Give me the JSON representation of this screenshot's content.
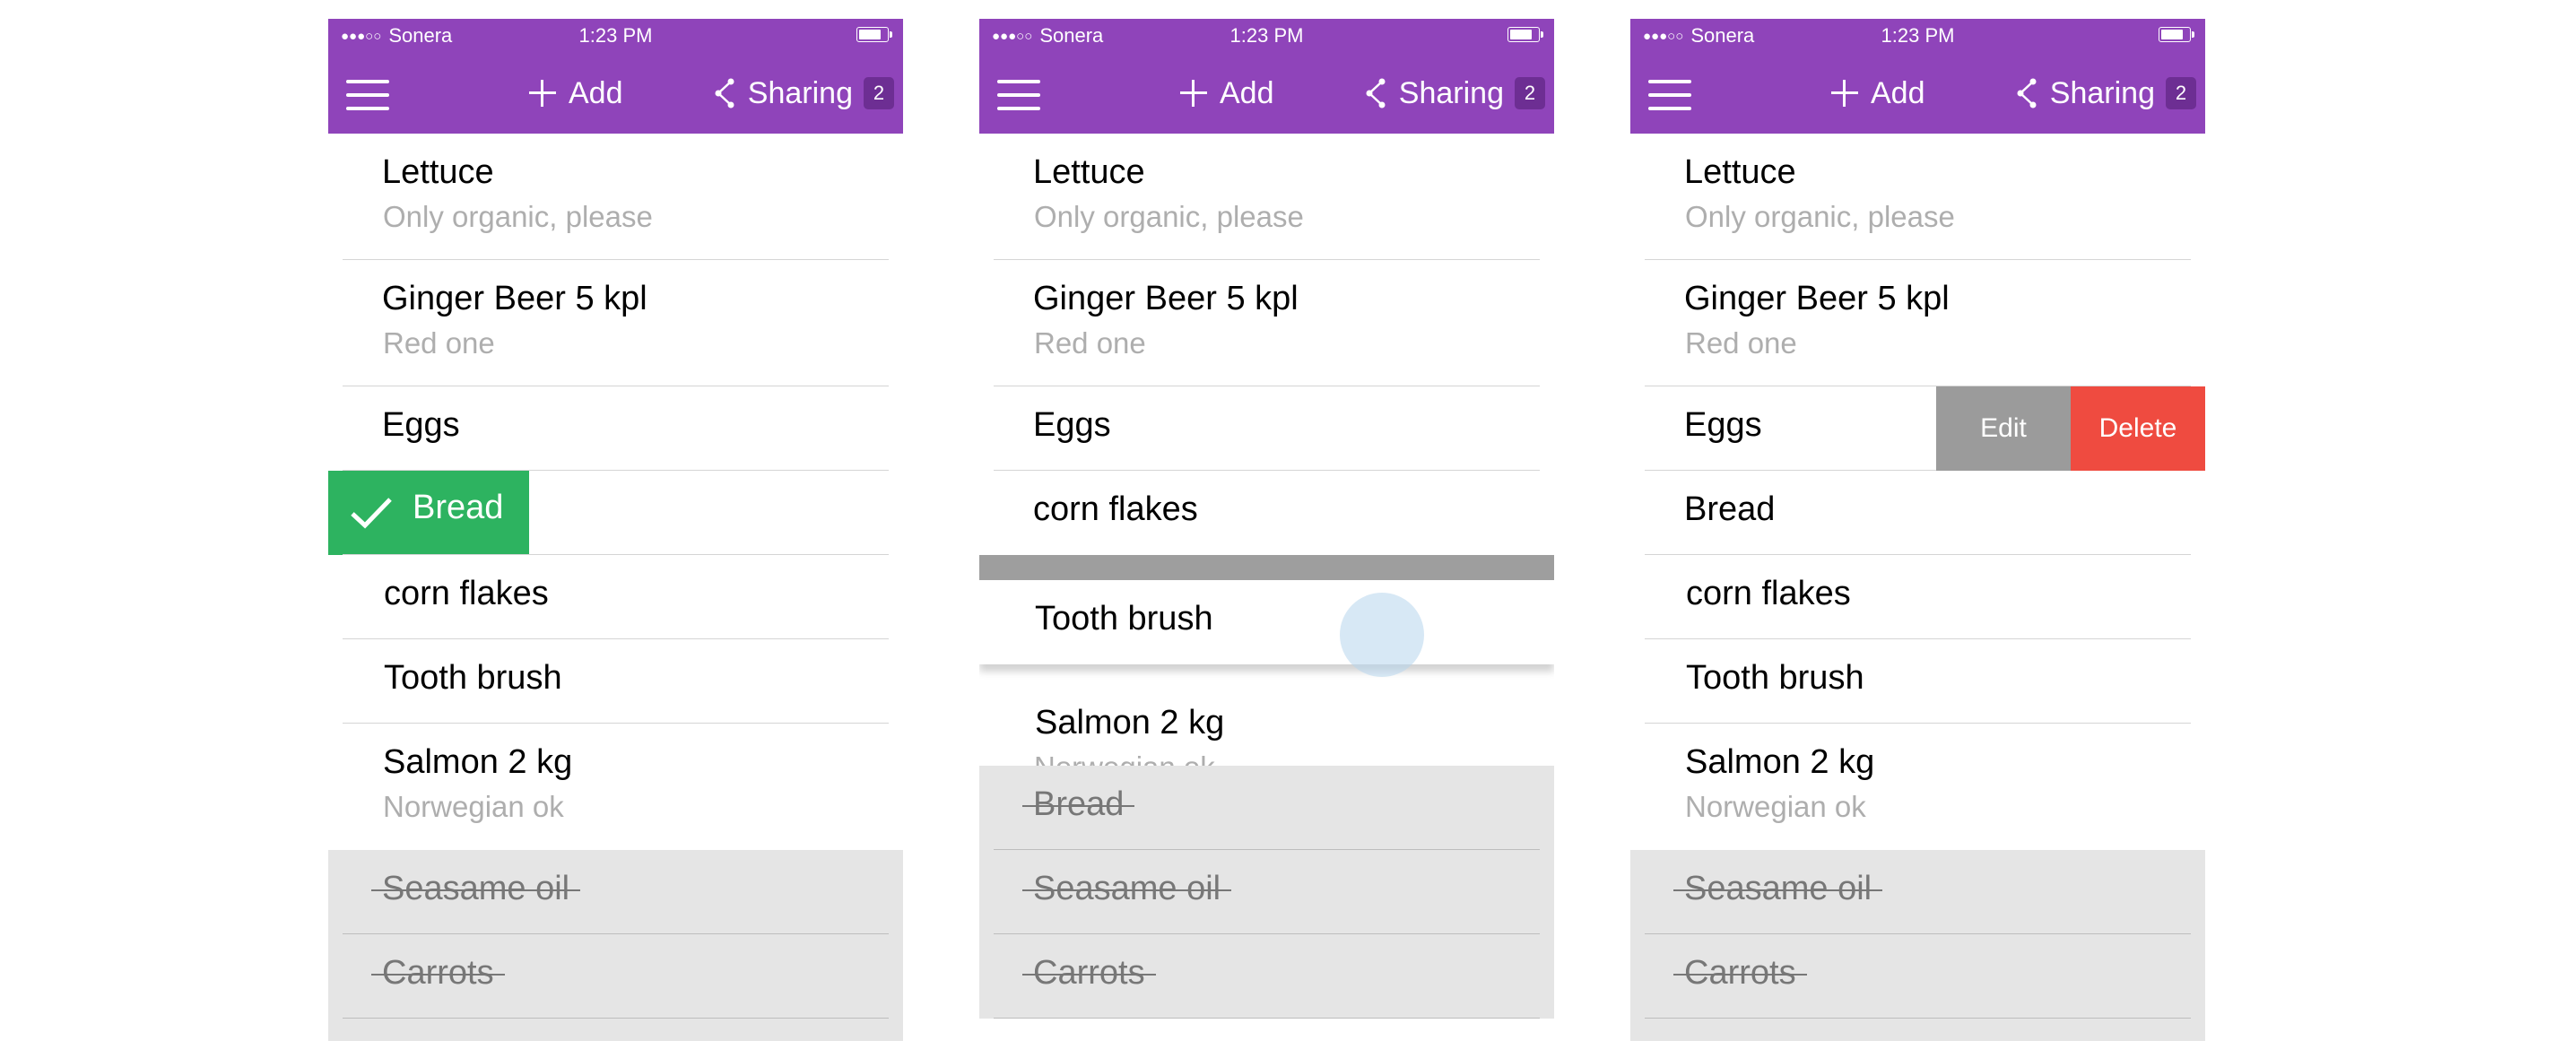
{
  "colors": {
    "brand": "#8f44ba",
    "badge": "#6d2e93",
    "check": "#2db360",
    "edit": "#9b9b9b",
    "delete": "#ef4b40",
    "completed_bg": "#e5e5e5"
  },
  "statusbar": {
    "carrier": "Sonera",
    "time": "1:23 PM"
  },
  "navbar": {
    "add_label": "Add",
    "sharing_label": "Sharing",
    "sharing_count": "2"
  },
  "screens": [
    {
      "state": "item checked by swipe",
      "items": [
        {
          "title": "Lettuce",
          "note": "Only organic, please"
        },
        {
          "title": "Ginger Beer 5 kpl",
          "note": "Red one"
        },
        {
          "title": "Eggs"
        },
        {
          "title": "Bread",
          "checked_indicator": true
        },
        {
          "title": "corn flakes"
        },
        {
          "title": "Tooth brush"
        },
        {
          "title": "Salmon 2 kg",
          "note": "Norwegian ok"
        }
      ],
      "completed": [
        {
          "title": "Seasame oil"
        },
        {
          "title": "Carrots"
        }
      ]
    },
    {
      "state": "item being dragged",
      "items": [
        {
          "title": "Lettuce",
          "note": "Only organic, please"
        },
        {
          "title": "Ginger Beer 5 kpl",
          "note": "Red one"
        },
        {
          "title": "Eggs"
        },
        {
          "title": "corn flakes"
        },
        {
          "title": "Tooth brush",
          "dragging": true
        },
        {
          "title": "Salmon 2 kg",
          "note": "Norwegian ok"
        }
      ],
      "completed": [
        {
          "title": "Bread"
        },
        {
          "title": "Seasame oil"
        },
        {
          "title": "Carrots"
        }
      ]
    },
    {
      "state": "row actions revealed",
      "items": [
        {
          "title": "Lettuce",
          "note": "Only organic, please"
        },
        {
          "title": "Ginger Beer 5 kpl",
          "note": "Red one"
        },
        {
          "title": "Eggs",
          "actions": {
            "edit": "Edit",
            "delete": "Delete"
          }
        },
        {
          "title": "Bread"
        },
        {
          "title": "corn flakes"
        },
        {
          "title": "Tooth brush"
        },
        {
          "title": "Salmon 2 kg",
          "note": "Norwegian ok"
        }
      ],
      "completed": [
        {
          "title": "Seasame oil"
        },
        {
          "title": "Carrots"
        }
      ]
    }
  ]
}
